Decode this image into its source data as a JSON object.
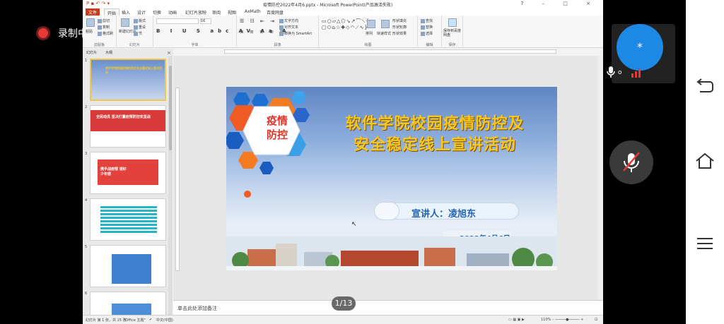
{
  "recording": {
    "label": "录制中"
  },
  "window": {
    "title": "疫情防控2022年4月6.pptx - Microsoft PowerPoint(产品激活失败)",
    "controls": "?  –  □  ×"
  },
  "menu": {
    "file": "文件",
    "tabs": [
      "开始",
      "插入",
      "设计",
      "切换",
      "动画",
      "幻灯片放映",
      "审阅",
      "视图",
      "AxMath",
      "百度网盘"
    ]
  },
  "ribbon": {
    "clipboard": {
      "name": "剪贴板",
      "paste": "粘贴",
      "cut": "剪切",
      "copy": "复制",
      "format_painter": "格式刷"
    },
    "slides": {
      "name": "幻灯片",
      "new_slide": "新建幻灯片",
      "layout": "版式",
      "reset": "重设",
      "section": "节"
    },
    "font": {
      "name": "字体",
      "size": "16"
    },
    "paragraph": {
      "name": "段落",
      "text_direction": "文字方向",
      "align_text": "对齐文本",
      "smartart": "转换为 SmartArt"
    },
    "drawing": {
      "name": "绘图",
      "arrange": "排列",
      "quick_styles": "快速样式",
      "shape_fill": "形状填充",
      "shape_outline": "形状轮廓",
      "shape_effects": "形状效果"
    },
    "editing": {
      "name": "编辑",
      "find": "查找",
      "replace": "替换",
      "select": "选择"
    },
    "save": {
      "name": "保存",
      "label": "保存到百度网盘"
    }
  },
  "panel": {
    "tab_slides": "幻灯片",
    "tab_outline": "大纲",
    "close": "×"
  },
  "thumbnails": [
    {
      "num": "1",
      "text": "软件学院校园疫情防控及安全稳定线上宣讲活动"
    },
    {
      "num": "2",
      "text": "全民动员 坚决打赢疫情防控攻坚战"
    },
    {
      "num": "3",
      "text": "携手战疫情 谱好少年感"
    },
    {
      "num": "4",
      "text": ""
    },
    {
      "num": "5",
      "text": ""
    },
    {
      "num": "6",
      "text": ""
    }
  ],
  "slide": {
    "badge": "疫情防控",
    "title_line1": "软件学院校园疫情防控及",
    "title_line2": "安全稳定线上宣讲活动",
    "speaker": "宣讲人：凌旭东",
    "date": "2022年4月6日"
  },
  "notes": {
    "placeholder": "单击此处添加备注"
  },
  "status": {
    "slide_info": "幻灯片 第 1 张，共 15 张",
    "theme": "\"Office 主题\"",
    "language": "中文(中国)",
    "zoom": "110%"
  },
  "page_counter": "1/13",
  "call": {
    "avatar_initial": "*"
  },
  "colors": {
    "accent": "#c43e1c",
    "title_gold": "#f7c71b",
    "speaker_blue": "#1d63b3",
    "avatar_blue": "#1e88e5"
  }
}
